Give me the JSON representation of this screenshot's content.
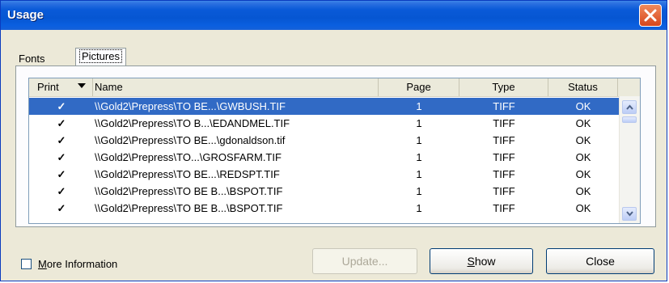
{
  "window": {
    "title": "Usage"
  },
  "tabs": [
    {
      "label": "Fonts"
    },
    {
      "label": "Pictures"
    }
  ],
  "table": {
    "columns": {
      "print": "Print",
      "name": "Name",
      "page": "Page",
      "type": "Type",
      "status": "Status"
    },
    "rows": [
      {
        "check": "✓",
        "name": "\\\\Gold2\\Prepress\\TO BE...\\GWBUSH.TIF",
        "page": "1",
        "type": "TIFF",
        "status": "OK"
      },
      {
        "check": "✓",
        "name": "\\\\Gold2\\Prepress\\TO B...\\EDANDMEL.TIF",
        "page": "1",
        "type": "TIFF",
        "status": "OK"
      },
      {
        "check": "✓",
        "name": "\\\\Gold2\\Prepress\\TO BE...\\gdonaldson.tif",
        "page": "1",
        "type": "TIFF",
        "status": "OK"
      },
      {
        "check": "✓",
        "name": "\\\\Gold2\\Prepress\\TO...\\GROSFARM.TIF",
        "page": "1",
        "type": "TIFF",
        "status": "OK"
      },
      {
        "check": "✓",
        "name": "\\\\Gold2\\Prepress\\TO BE...\\REDSPT.TIF",
        "page": "1",
        "type": "TIFF",
        "status": "OK"
      },
      {
        "check": "✓",
        "name": "\\\\Gold2\\Prepress\\TO BE B...\\BSPOT.TIF",
        "page": "1",
        "type": "TIFF",
        "status": "OK"
      },
      {
        "check": "✓",
        "name": "\\\\Gold2\\Prepress\\TO BE B...\\BSPOT.TIF",
        "page": "1",
        "type": "TIFF",
        "status": "OK"
      }
    ]
  },
  "footer": {
    "more_info": {
      "label_first": "M",
      "label_rest": "ore Information"
    },
    "update": {
      "label": "Update..."
    },
    "show": {
      "label_first": "S",
      "label_rest": "how"
    },
    "close": {
      "label": "Close"
    }
  },
  "colors": {
    "titlebar": "#0656d2",
    "selection": "#316ac5",
    "close_button": "#d7461c"
  },
  "icons": {
    "close": "close-icon",
    "sort": "dropdown-arrow-icon",
    "scroll_up": "chevron-up-icon",
    "scroll_down": "chevron-down-icon"
  }
}
